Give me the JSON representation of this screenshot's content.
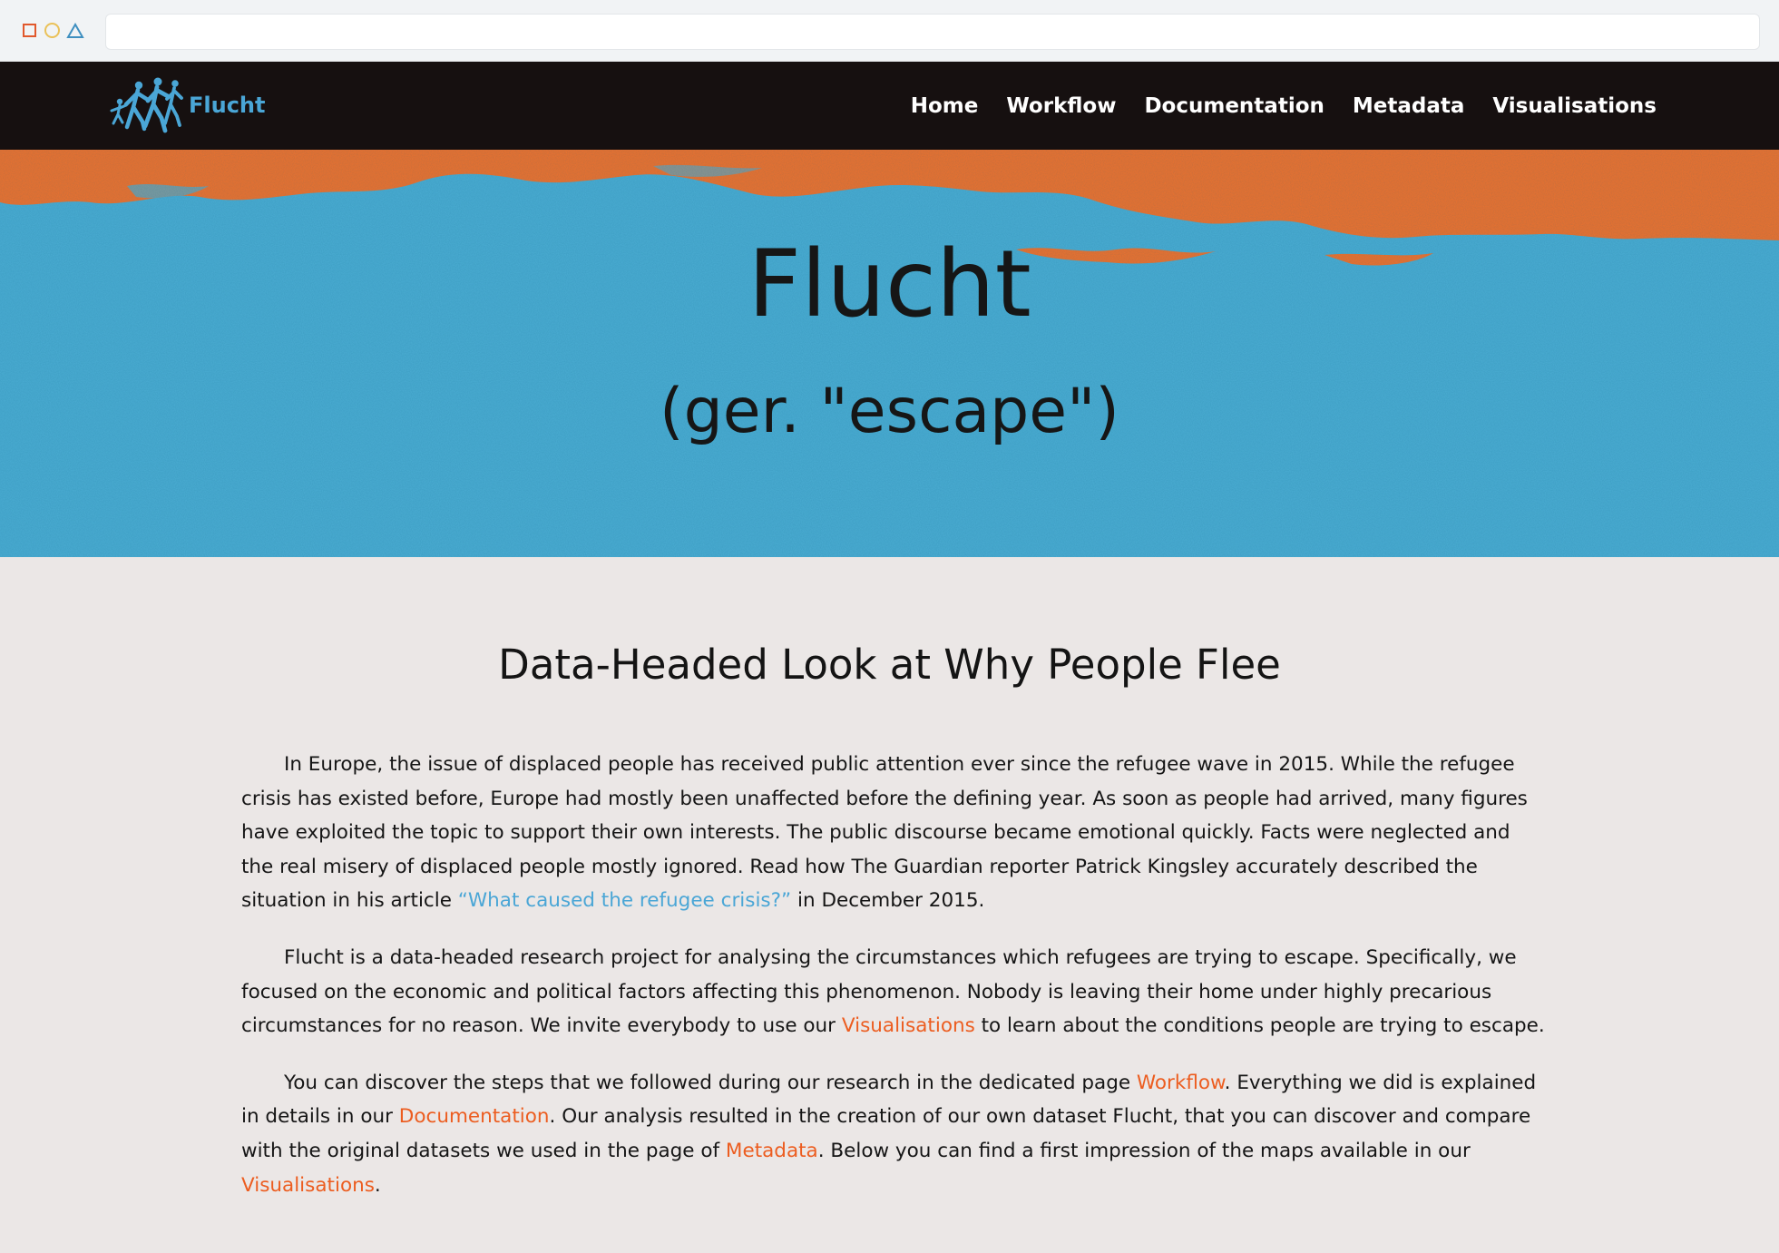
{
  "browser": {
    "address": ""
  },
  "nav": {
    "brand": "Flucht",
    "links": [
      "Home",
      "Workflow",
      "Documentation",
      "Metadata",
      "Visualisations"
    ]
  },
  "hero": {
    "title": "Flucht",
    "subtitle": "(ger. \"escape\")"
  },
  "content": {
    "heading": "Data-Headed Look at Why People Flee",
    "p1": {
      "text": "In Europe, the issue of displaced people has received public attention ever since the refugee wave in 2015. While the refugee crisis has existed before, Europe had mostly been unaffected before the defining year. As soon as people had arrived, many figures have exploited the topic to support their own interests. The public discourse became emotional quickly. Facts were neglected and the real misery of displaced people mostly ignored. Read how The Guardian reporter Patrick Kingsley accurately described the situation in his article ",
      "link": "“What caused the refugee crisis?”",
      "after": " in December 2015."
    },
    "p2": {
      "text": "Flucht is a data-headed research project for analysing the circumstances which refugees are trying to escape. Specifically, we focused on the economic and political factors affecting this phenomenon. Nobody is leaving their home under highly precarious circumstances for no reason. We invite everybody to use our ",
      "link": "Visualisations",
      "after": " to learn about the conditions people are trying to escape."
    },
    "p3": {
      "text1": "You can discover the steps that we followed during our research in the dedicated page ",
      "link1": "Workflow",
      "text2": ". Everything we did is explained in details in our ",
      "link2": "Documentation",
      "text3": ". Our analysis resulted in the creation of our own dataset Flucht, that you can discover and compare with the original datasets we used in the page of ",
      "link3": "Metadata",
      "text4": ". Below you can find a first impression of the maps available in our ",
      "link4": "Visualisations",
      "text5": "."
    }
  },
  "colors": {
    "nav_bg": "#161010",
    "brand_blue": "#4aa6d6",
    "hero_blue": "#4badd3",
    "hero_orange": "#ef722e",
    "link_orange": "#ec5d20",
    "page_bg": "#ebe7e6"
  },
  "icons": {
    "window_controls": [
      "close-square-icon",
      "minimize-circle-icon",
      "maximize-triangle-icon"
    ],
    "brand_logo": "fleeing-family-icon"
  }
}
